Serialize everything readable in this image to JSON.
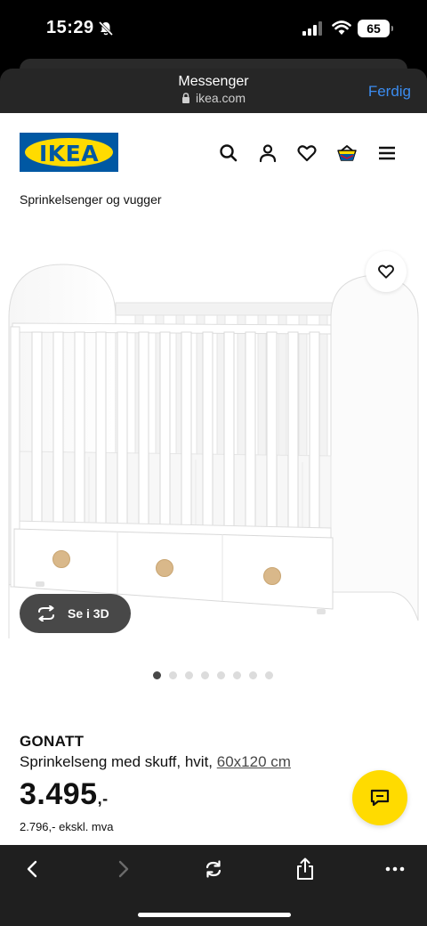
{
  "status_bar": {
    "time": "15:29",
    "battery": "65"
  },
  "browser": {
    "title": "Messenger",
    "url": "ikea.com",
    "done_label": "Ferdig"
  },
  "site": {
    "logo_text": "IKEA",
    "brand_blue": "#0058a3",
    "brand_yellow": "#ffdb00"
  },
  "header_icons": [
    "search-icon",
    "account-icon",
    "heart-icon",
    "basket-icon",
    "menu-icon"
  ],
  "breadcrumb": "Sprinkelsenger og vugger",
  "gallery": {
    "view_3d_label": "Se i 3D",
    "image_count": 8,
    "active_index": 0
  },
  "product": {
    "name": "GONATT",
    "description": "Sprinkelseng med skuff, hvit,",
    "size": "60x120 cm",
    "price": "3.495",
    "price_suffix": ",-",
    "price_ex_vat": "2.796,- ekskl. mva"
  },
  "toolbar_icons": [
    "back-icon",
    "forward-icon",
    "reload-icon",
    "share-icon",
    "more-icon"
  ]
}
